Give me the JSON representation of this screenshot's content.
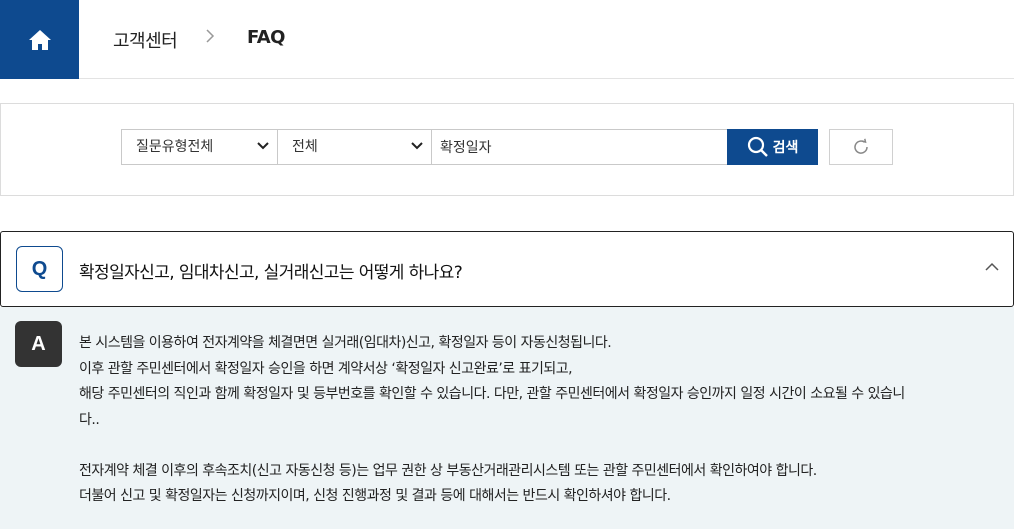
{
  "breadcrumb": {
    "items": [
      "고객센터",
      "FAQ"
    ],
    "separator_icon": "chevron-right-icon",
    "home_icon": "home-icon"
  },
  "search": {
    "category_select": "질문유형전체",
    "type_select": "전체",
    "keyword": "확정일자",
    "search_label": "검색",
    "search_icon": "search-icon",
    "reset_icon": "refresh-icon"
  },
  "faq": {
    "q_badge": "Q",
    "question": "확정일자신고, 임대차신고, 실거래신고는 어떻게 하나요?",
    "toggle_icon": "chevron-up-icon",
    "a_badge": "A",
    "answer_lines": [
      "본 시스템을 이용하여 전자계약을 체결면면 실거래(임대차)신고, 확정일자 등이 자동신청됩니다.",
      "이후 관할 주민센터에서 확정일자 승인을 하면 계약서상 ‘확정일자 신고완료’로 표기되고,",
      "해당 주민센터의 직인과 함께 확정일자 및 등부번호를 확인할 수 있습니다. 다만, 관할 주민센터에서 확정일자 승인까지 일정 시간이 소요될 수 있습니",
      "다..",
      "",
      "전자계약 체결 이후의 후속조치(신고 자동신청 등)는 업무 권한 상 부동산거래관리시스템 또는 관할 주민센터에서 확인하여야 합니다.",
      "더불어 신고 및 확정일자는 신청까지이며, 신청 진행과정 및 결과 등에 대해서는 반드시 확인하셔야 합니다."
    ]
  },
  "colors": {
    "brand": "#0e4a8f",
    "answer_bg": "#eef4f6",
    "a_badge_bg": "#333333"
  }
}
